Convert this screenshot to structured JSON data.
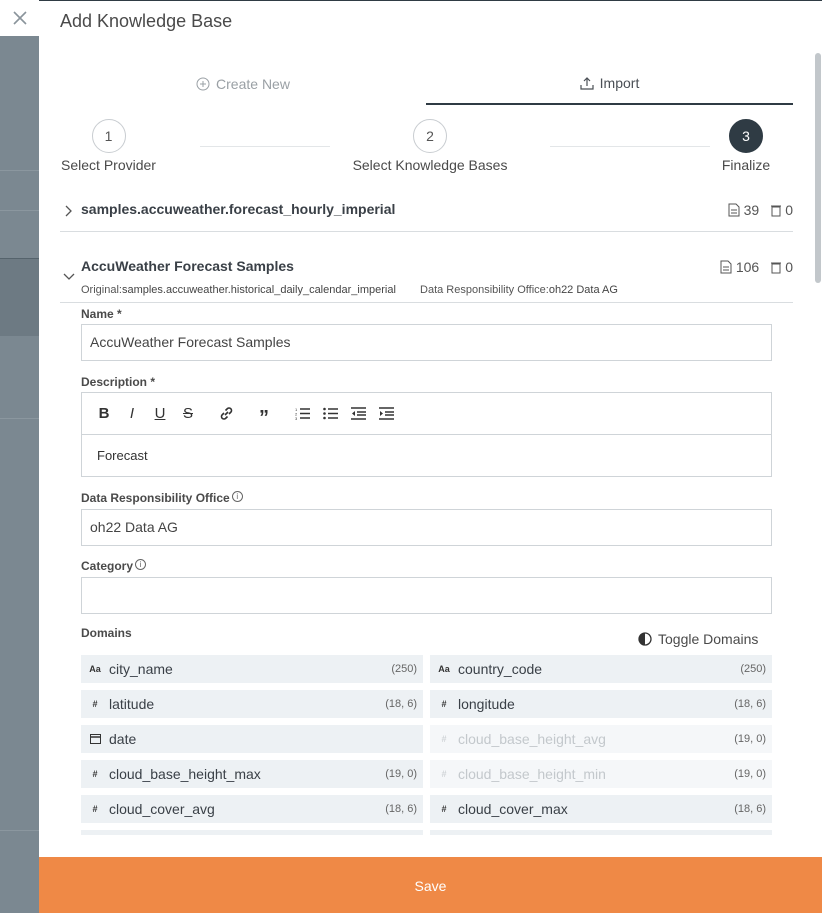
{
  "header": {
    "title": "Add Knowledge Base"
  },
  "tabs": [
    {
      "label": "Create New",
      "icon": "plus-circle-icon"
    },
    {
      "label": "Import",
      "icon": "upload-icon"
    }
  ],
  "stepper": [
    {
      "number": "1",
      "label": "Select Provider"
    },
    {
      "number": "2",
      "label": "Select Knowledge Bases"
    },
    {
      "number": "3",
      "label": "Finalize"
    }
  ],
  "kb_collapsed": {
    "name": "samples.accuweather.forecast_hourly_imperial",
    "docs": "39",
    "items": "0"
  },
  "kb_expanded": {
    "name": "AccuWeather Forecast Samples",
    "docs": "106",
    "items": "0",
    "original_label": "Original:",
    "original_value": "samples.accuweather.historical_daily_calendar_imperial",
    "dro_label": "Data Responsibility Office:",
    "dro_value": "oh22 Data AG"
  },
  "form": {
    "name_label": "Name *",
    "name_value": "AccuWeather Forecast Samples",
    "description_label": "Description *",
    "description_value": "Forecast",
    "dro_label": "Data Responsibility Office",
    "dro_value": "oh22 Data AG",
    "category_label": "Category",
    "category_value": "",
    "domains_label": "Domains",
    "toggle_domains": "Toggle Domains"
  },
  "domains": [
    {
      "type": "Aa",
      "name": "city_name",
      "prec": "(250)",
      "disabled": false
    },
    {
      "type": "Aa",
      "name": "country_code",
      "prec": "(250)",
      "disabled": false
    },
    {
      "type": "#",
      "name": "latitude",
      "prec": "(18, 6)",
      "disabled": false
    },
    {
      "type": "#",
      "name": "longitude",
      "prec": "(18, 6)",
      "disabled": false
    },
    {
      "type": "cal",
      "name": "date",
      "prec": "",
      "disabled": false
    },
    {
      "type": "#",
      "name": "cloud_base_height_avg",
      "prec": "(19, 0)",
      "disabled": true
    },
    {
      "type": "#",
      "name": "cloud_base_height_max",
      "prec": "(19, 0)",
      "disabled": false
    },
    {
      "type": "#",
      "name": "cloud_base_height_min",
      "prec": "(19, 0)",
      "disabled": true
    },
    {
      "type": "#",
      "name": "cloud_cover_avg",
      "prec": "(18, 6)",
      "disabled": false
    },
    {
      "type": "#",
      "name": "cloud_cover_max",
      "prec": "(18, 6)",
      "disabled": false
    }
  ],
  "footer": {
    "save_label": "Save"
  },
  "colors": {
    "accent": "#ef8946",
    "dark": "#2f3b44"
  }
}
